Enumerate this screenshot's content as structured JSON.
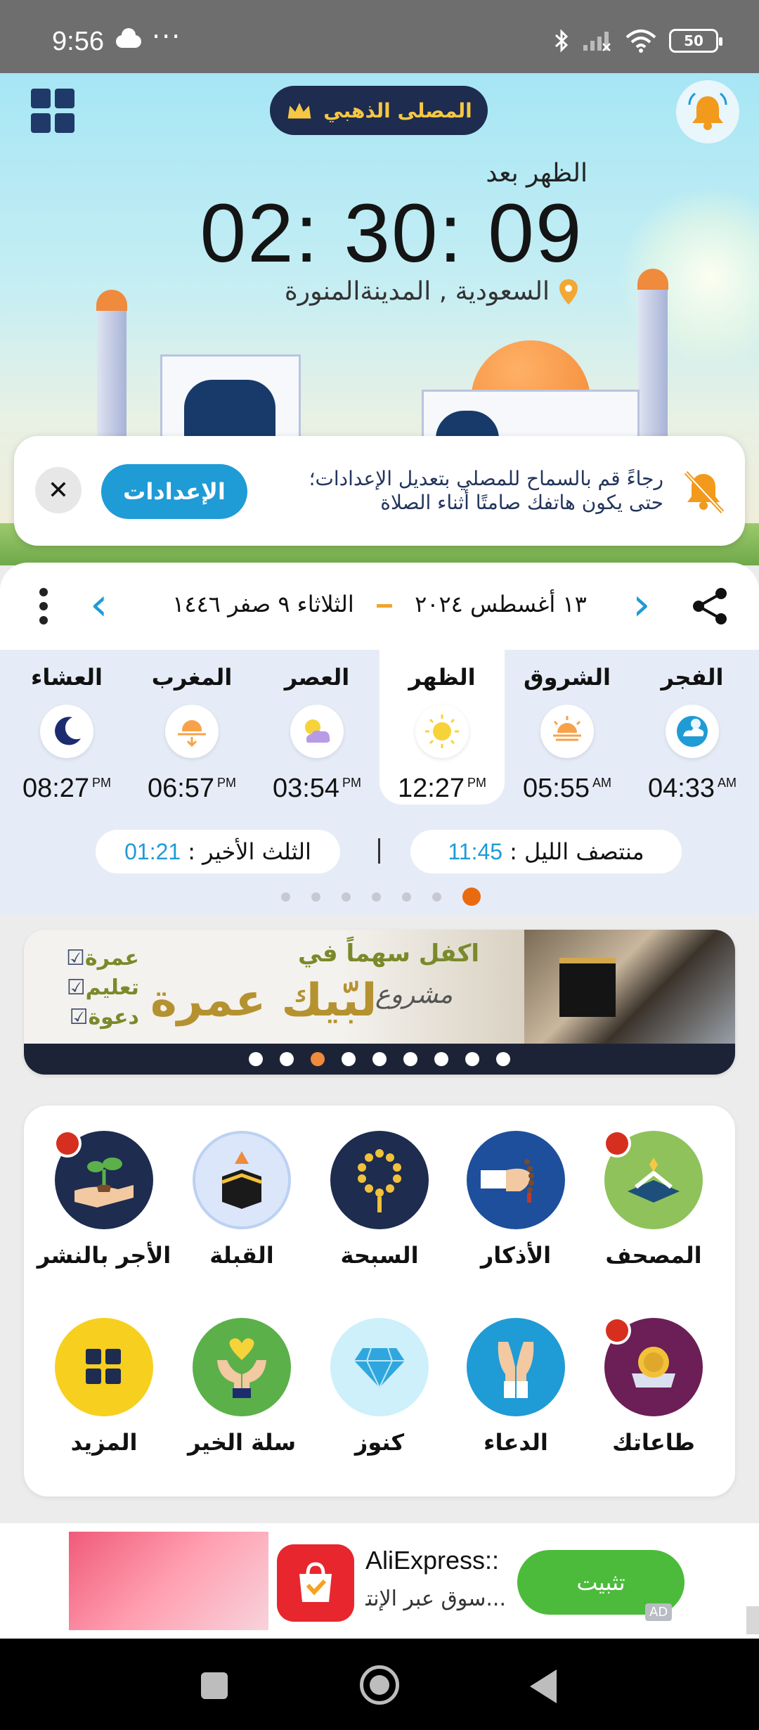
{
  "status_bar": {
    "time": "9:56",
    "more": "···",
    "battery": "50",
    "icons": [
      "cloud-icon",
      "bluetooth-icon",
      "signal-icon",
      "wifi-icon",
      "battery-icon"
    ]
  },
  "header": {
    "badge_label": "المصلى الذهبي",
    "grid_icon": "apps-grid-icon",
    "bell_icon": "bell-icon"
  },
  "countdown": {
    "label": "الظهر بعد",
    "time": "02: 30: 09",
    "location": "السعودية , المدينةالمنورة"
  },
  "notice": {
    "text_line1": "رجاءً قم بالسماح للمصلي بتعديل الإعدادات؛",
    "text_line2": "حتى يكون هاتفك صامتًا أثناء الصلاة",
    "button": "الإعدادات",
    "close": "✕"
  },
  "date_bar": {
    "gregorian": "١٣ أغسطس ٢٠٢٤",
    "hijri": "الثلاثاء  ٩ صفر ١٤٤٦"
  },
  "prayers": [
    {
      "name": "الفجر",
      "time": "04:33",
      "ampm": "AM",
      "icon": "fajr-cloud-moon-icon"
    },
    {
      "name": "الشروق",
      "time": "05:55",
      "ampm": "AM",
      "icon": "sunrise-icon"
    },
    {
      "name": "الظهر",
      "time": "12:27",
      "ampm": "PM",
      "icon": "sun-icon",
      "active": true
    },
    {
      "name": "العصر",
      "time": "03:54",
      "ampm": "PM",
      "icon": "cloud-sun-icon"
    },
    {
      "name": "المغرب",
      "time": "06:57",
      "ampm": "PM",
      "icon": "sunset-icon"
    },
    {
      "name": "العشاء",
      "time": "08:27",
      "ampm": "PM",
      "icon": "moon-icon"
    }
  ],
  "night": {
    "midnight_label": "منتصف الليل :",
    "midnight_value": "11:45",
    "last_third_label": "الثلث الأخير :",
    "last_third_value": "01:21"
  },
  "pager": {
    "count": 7,
    "active": 0
  },
  "banner": {
    "line1": "اكفل سهماً في",
    "line2": "لبّيك عمرة",
    "line3": "مشروع",
    "list": [
      "عمرة",
      "تعليم",
      "دعوة"
    ],
    "dots_count": 9,
    "dots_active": 2
  },
  "features": [
    {
      "label": "المصحف",
      "icon": "quran-icon",
      "bg": "#8fc25a",
      "badge": true
    },
    {
      "label": "الأذكار",
      "icon": "dhikr-hand-icon",
      "bg": "#1d4f9c",
      "badge": false
    },
    {
      "label": "السبحة",
      "icon": "tasbih-beads-icon",
      "bg": "#1d2c4f",
      "badge": false
    },
    {
      "label": "القبلة",
      "icon": "qibla-kaaba-icon",
      "bg": "#dbe6fb",
      "badge": false
    },
    {
      "label": "الأجر بالنشر",
      "icon": "plant-hand-icon",
      "bg": "#1d2c4f",
      "badge": true
    },
    {
      "label": "طاعاتك",
      "icon": "medal-icon",
      "bg": "#6b1f56",
      "badge": true
    },
    {
      "label": "الدعاء",
      "icon": "praying-hands-icon",
      "bg": "#1f9bd6",
      "badge": false
    },
    {
      "label": "كنوز",
      "icon": "diamond-icon",
      "bg": "#cdf0fa",
      "badge": false
    },
    {
      "label": "سلة الخير",
      "icon": "heart-hands-icon",
      "bg": "#5bb04a",
      "badge": false
    },
    {
      "label": "المزيد",
      "icon": "more-grid-icon",
      "bg": "#f7cf1f",
      "badge": false
    }
  ],
  "ad": {
    "title": "AliExpress::",
    "subtitle": "...سوق عبر الإنتر",
    "button": "تثبيت",
    "tag": "AD"
  },
  "nav": {
    "recent": "recent-apps-icon",
    "home": "home-icon",
    "back": "back-icon"
  },
  "colors": {
    "accent": "#1f9bd6",
    "orange": "#ea6a10",
    "navy": "#1d2c4f",
    "gold": "#f7c743"
  }
}
